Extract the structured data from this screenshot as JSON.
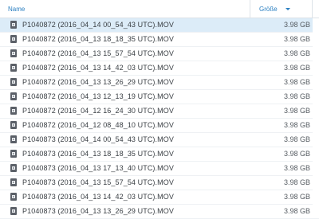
{
  "header": {
    "name_label": "Name",
    "size_label": "Größe"
  },
  "files": [
    {
      "name": "P1040872 (2016_04_14 00_54_43 UTC).MOV",
      "size": "3.98 GB",
      "selected": true
    },
    {
      "name": "P1040872 (2016_04_13 18_18_35 UTC).MOV",
      "size": "3.98 GB"
    },
    {
      "name": "P1040872 (2016_04_13 15_57_54 UTC).MOV",
      "size": "3.98 GB"
    },
    {
      "name": "P1040872 (2016_04_13 14_42_03 UTC).MOV",
      "size": "3.98 GB"
    },
    {
      "name": "P1040872 (2016_04_13 13_26_29 UTC).MOV",
      "size": "3.98 GB"
    },
    {
      "name": "P1040872 (2016_04_13 12_13_19 UTC).MOV",
      "size": "3.98 GB"
    },
    {
      "name": "P1040872 (2016_04_12 16_24_30 UTC).MOV",
      "size": "3.98 GB"
    },
    {
      "name": "P1040872 (2016_04_12 08_48_10 UTC).MOV",
      "size": "3.98 GB"
    },
    {
      "name": "P1040873 (2016_04_14 00_54_43 UTC).MOV",
      "size": "3.98 GB"
    },
    {
      "name": "P1040873 (2016_04_13 18_18_35 UTC).MOV",
      "size": "3.98 GB"
    },
    {
      "name": "P1040873 (2016_04_13 17_13_40 UTC).MOV",
      "size": "3.98 GB"
    },
    {
      "name": "P1040873 (2016_04_13 15_57_54 UTC).MOV",
      "size": "3.98 GB"
    },
    {
      "name": "P1040873 (2016_04_13 14_42_03 UTC).MOV",
      "size": "3.98 GB"
    },
    {
      "name": "P1040873 (2016_04_13 13_26_29 UTC).MOV",
      "size": "3.98 GB"
    }
  ],
  "icons": {
    "file": "video-file-icon",
    "sort": "sort-descending-icon"
  },
  "colors": {
    "header_text": "#2a7fc1",
    "selected_row": "#dcecf8"
  }
}
